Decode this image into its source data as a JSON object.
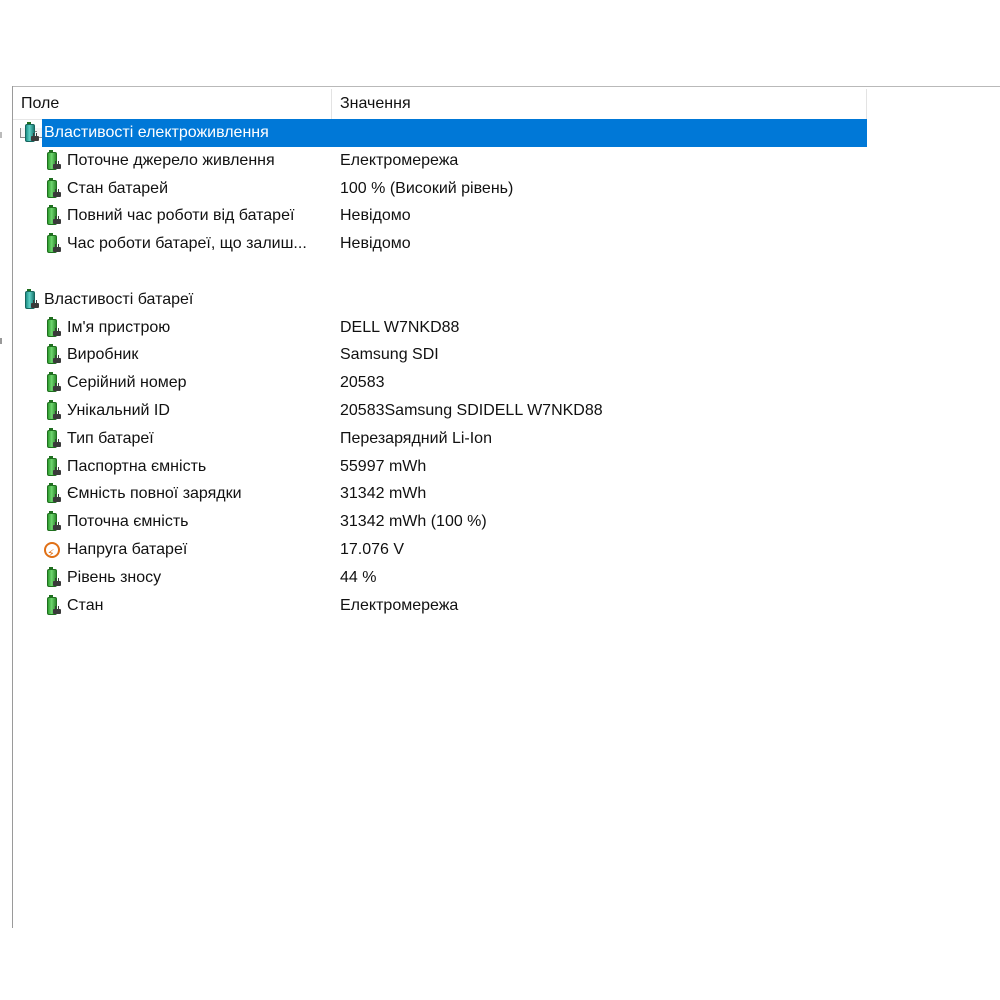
{
  "columns": {
    "field": "Поле",
    "value": "Значення"
  },
  "groups": [
    {
      "title": "Властивості електроживлення",
      "selected": true,
      "icon": "battery-plug-icon",
      "items": [
        {
          "field": "Поточне джерело живлення",
          "value": "Електромережа",
          "icon": "battery-plug-icon"
        },
        {
          "field": "Стан батарей",
          "value": "100 % (Високий рівень)",
          "icon": "battery-plug-icon"
        },
        {
          "field": "Повний час роботи від батареї",
          "value": "Невідомо",
          "icon": "battery-plug-icon"
        },
        {
          "field": "Час роботи батареї, що залиш...",
          "value": "Невідомо",
          "icon": "battery-plug-icon"
        }
      ]
    },
    {
      "title": "Властивості батареї",
      "selected": false,
      "icon": "battery-plug-icon",
      "items": [
        {
          "field": "Ім'я пристрою",
          "value": "DELL W7NKD88",
          "icon": "battery-plug-icon"
        },
        {
          "field": "Виробник",
          "value": "Samsung SDI",
          "icon": "battery-plug-icon"
        },
        {
          "field": "Серійний номер",
          "value": "20583",
          "icon": "battery-plug-icon"
        },
        {
          "field": "Унікальний ID",
          "value": "20583Samsung SDIDELL W7NKD88",
          "icon": "battery-plug-icon"
        },
        {
          "field": "Тип батареї",
          "value": "Перезарядний Li-Ion",
          "icon": "battery-plug-icon"
        },
        {
          "field": "Паспортна ємність",
          "value": "55997 mWh",
          "icon": "battery-plug-icon"
        },
        {
          "field": "Ємність повної зарядки",
          "value": "31342 mWh",
          "icon": "battery-plug-icon"
        },
        {
          "field": "Поточна ємність",
          "value": "31342 mWh  (100 %)",
          "icon": "battery-plug-icon"
        },
        {
          "field": "Напруга батареї",
          "value": "17.076 V",
          "icon": "voltage-icon"
        },
        {
          "field": "Рівень зносу",
          "value": "44 %",
          "icon": "battery-plug-icon"
        },
        {
          "field": "Стан",
          "value": "Електромережа",
          "icon": "battery-plug-icon"
        }
      ]
    }
  ],
  "colors": {
    "selection": "#0078d7",
    "battery_green": "#3fbf2a",
    "voltage_orange": "#e07016"
  }
}
